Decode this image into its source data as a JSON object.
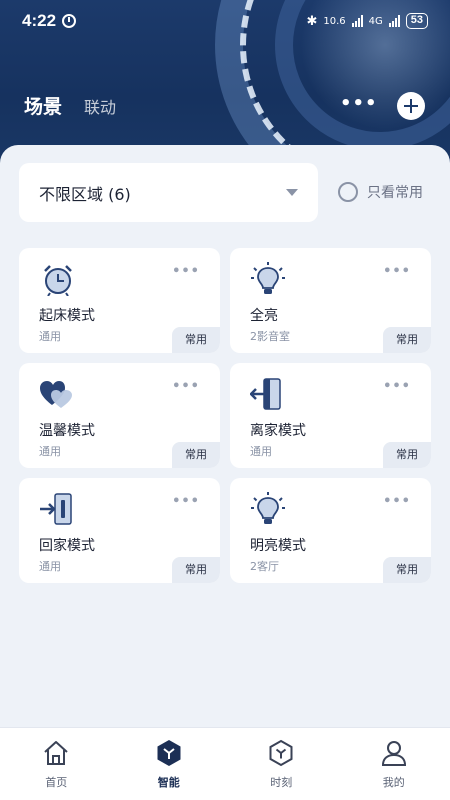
{
  "status_bar": {
    "time": "4:22",
    "net_speed": "10.6",
    "signal_label": "4G",
    "battery": "53"
  },
  "header": {
    "tabs": [
      {
        "label": "场景",
        "active": true
      },
      {
        "label": "联动",
        "active": false
      }
    ],
    "more_icon": "more-dots-icon",
    "add_icon": "plus-circle-icon"
  },
  "filter": {
    "selected": "不限区域 (6)",
    "only_common_label": "只看常用",
    "only_common_checked": false
  },
  "scenes": [
    {
      "name": "起床模式",
      "sub": "通用",
      "badge": "常用",
      "icon": "alarm-clock-icon"
    },
    {
      "name": "全亮",
      "sub": "2影音室",
      "badge": "常用",
      "icon": "light-bulb-icon"
    },
    {
      "name": "温馨模式",
      "sub": "通用",
      "badge": "常用",
      "icon": "hearts-icon"
    },
    {
      "name": "离家模式",
      "sub": "通用",
      "badge": "常用",
      "icon": "leave-home-icon"
    },
    {
      "name": "回家模式",
      "sub": "通用",
      "badge": "常用",
      "icon": "return-home-icon"
    },
    {
      "name": "明亮模式",
      "sub": "2客厅",
      "badge": "常用",
      "icon": "light-bulb-icon"
    }
  ],
  "bottom_nav": [
    {
      "label": "首页",
      "icon": "home-icon",
      "active": false
    },
    {
      "label": "智能",
      "icon": "smart-hexagon-icon",
      "active": true
    },
    {
      "label": "时刻",
      "icon": "moment-hexagon-icon",
      "active": false
    },
    {
      "label": "我的",
      "icon": "profile-icon",
      "active": false
    }
  ],
  "colors": {
    "header_bg": "#1c3a6b",
    "accent": "#1c2f55",
    "page_bg": "#eef2f8",
    "badge_bg": "#e6ebf3"
  }
}
